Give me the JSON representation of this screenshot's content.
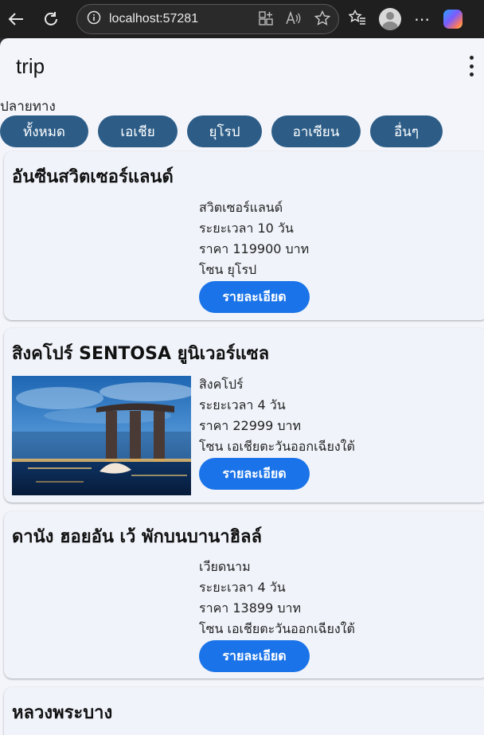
{
  "browser": {
    "url": "localhost:57281"
  },
  "app": {
    "title": "trip",
    "section_label": "ปลายทาง",
    "filters": [
      "ทั้งหมด",
      "เอเชีย",
      "ยุโรป",
      "อาเซียน",
      "อื่นๆ"
    ]
  },
  "trips": [
    {
      "title": "อันซีนสวิตเซอร์แลนด์",
      "country": "สวิตเซอร์แลนด์",
      "duration": "ระยะเวลา 10 วัน",
      "price": "ราคา 119900 บาท",
      "zone": "โซน ยุโรป",
      "button": "รายละเอียด"
    },
    {
      "title": "สิงคโปร์ SENTOSA ยูนิเวอร์แซล",
      "country": "สิงคโปร์",
      "duration": "ระยะเวลา 4 วัน",
      "price": "ราคา 22999 บาท",
      "zone": "โซน เอเชียตะวันออกเฉียงใต้",
      "button": "รายละเอียด"
    },
    {
      "title": "ดานัง ฮอยอัน เว้ พักบนบานาฮิลล์",
      "country": "เวียดนาม",
      "duration": "ระยะเวลา 4 วัน",
      "price": "ราคา 13899 บาท",
      "zone": "โซน เอเชียตะวันออกเฉียงใต้",
      "button": "รายละเอียด"
    },
    {
      "title": "หลวงพระบาง"
    }
  ]
}
